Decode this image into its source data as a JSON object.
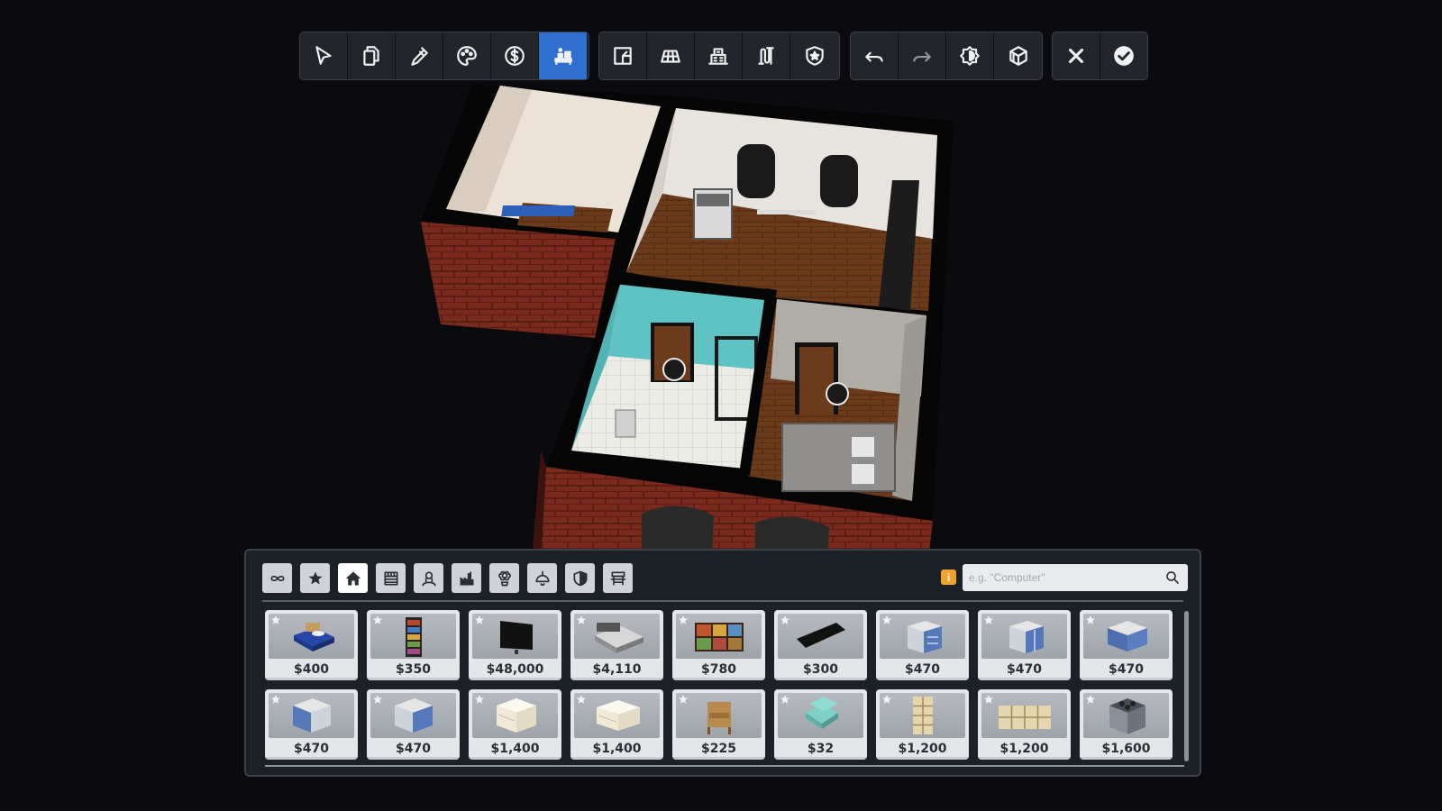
{
  "toolbar": {
    "groups": [
      [
        {
          "icon": "cursor-icon",
          "label": "Select"
        },
        {
          "icon": "copy-icon",
          "label": "Copy"
        },
        {
          "icon": "eyedropper-icon",
          "label": "Pick"
        },
        {
          "icon": "palette-icon",
          "label": "Paint"
        },
        {
          "icon": "dollar-icon",
          "label": "Sell"
        },
        {
          "icon": "furniture-icon",
          "label": "Furniture",
          "active": true
        }
      ],
      [
        {
          "icon": "room-icon",
          "label": "Room"
        },
        {
          "icon": "floor-icon",
          "label": "Floor"
        },
        {
          "icon": "building-icon",
          "label": "Building"
        },
        {
          "icon": "pipes-icon",
          "label": "Pipes"
        },
        {
          "icon": "shield-star-icon",
          "label": "Security"
        }
      ],
      [
        {
          "icon": "undo-icon",
          "label": "Undo"
        },
        {
          "icon": "redo-icon",
          "label": "Redo"
        },
        {
          "icon": "lighting-icon",
          "label": "Lighting"
        },
        {
          "icon": "walls-icon",
          "label": "Walls"
        }
      ],
      [
        {
          "icon": "close-icon",
          "label": "Cancel"
        },
        {
          "icon": "confirm-icon",
          "label": "Confirm"
        }
      ]
    ]
  },
  "catalog": {
    "categories": [
      {
        "icon": "infinity-icon"
      },
      {
        "icon": "star-icon"
      },
      {
        "icon": "home-icon",
        "active": true
      },
      {
        "icon": "store-icon"
      },
      {
        "icon": "worker-icon"
      },
      {
        "icon": "factory-icon"
      },
      {
        "icon": "plant-icon"
      },
      {
        "icon": "ceiling-lamp-icon"
      },
      {
        "icon": "shield-icon"
      },
      {
        "icon": "bench-icon"
      }
    ],
    "info_badge": "i",
    "search_placeholder": "e.g. \"Computer\"",
    "items": [
      {
        "icon": "single-bed-icon",
        "price": "$400"
      },
      {
        "icon": "bookshelf-icon",
        "price": "$350"
      },
      {
        "icon": "tv-icon",
        "price": "$48,000"
      },
      {
        "icon": "double-bed-icon",
        "price": "$4,110"
      },
      {
        "icon": "wide-bookshelf-icon",
        "price": "$780"
      },
      {
        "icon": "flat-tv-icon",
        "price": "$300"
      },
      {
        "icon": "drawer-cabinet-icon",
        "price": "$470"
      },
      {
        "icon": "door-cabinet-icon",
        "price": "$470"
      },
      {
        "icon": "counter-cabinet-icon",
        "price": "$470"
      },
      {
        "icon": "corner-cabinet-icon",
        "price": "$470"
      },
      {
        "icon": "corner-cabinet-2-icon",
        "price": "$470"
      },
      {
        "icon": "white-cabinet-icon",
        "price": "$1,400"
      },
      {
        "icon": "white-cabinet-2-icon",
        "price": "$1,400"
      },
      {
        "icon": "nightstand-icon",
        "price": "$225"
      },
      {
        "icon": "jewelry-box-icon",
        "price": "$32"
      },
      {
        "icon": "cube-shelf-tall-icon",
        "price": "$1,200"
      },
      {
        "icon": "cube-shelf-wide-icon",
        "price": "$1,200"
      },
      {
        "icon": "stove-icon",
        "price": "$1,600"
      }
    ]
  },
  "colors": {
    "accent": "#2f6fd0",
    "background": "#0b0a0e",
    "teal_wall": "#5bc3c5",
    "brick": "#7d2a1f",
    "wood_floor": "#6b3d1e",
    "info_badge": "#f0a22c"
  }
}
